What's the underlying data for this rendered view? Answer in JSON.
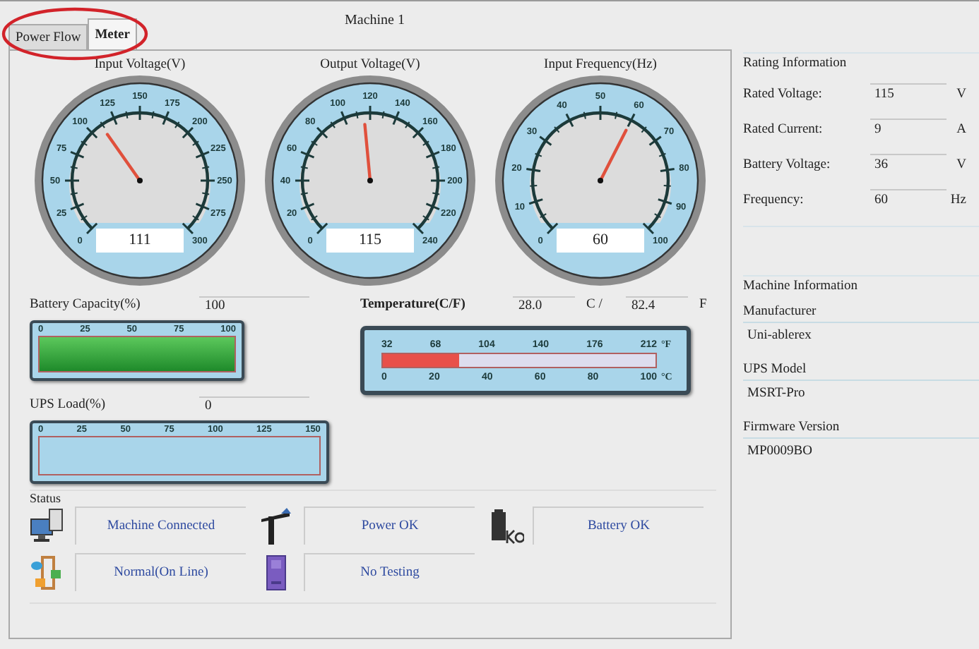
{
  "window": {
    "title": "Machine 1"
  },
  "tabs": [
    {
      "label": "Power Flow",
      "selected": false
    },
    {
      "label": "Meter",
      "selected": true
    }
  ],
  "annotations": [
    {
      "kind": "ellipse"
    }
  ],
  "gauges": [
    {
      "title": "Input Voltage(V)",
      "ticks": [
        "0",
        "25",
        "50",
        "75",
        "100",
        "125",
        "150",
        "175",
        "200",
        "225",
        "250",
        "275",
        "300"
      ],
      "level": 0.37,
      "value": "111"
    },
    {
      "title": "Output Voltage(V)",
      "ticks": [
        "0",
        "20",
        "40",
        "60",
        "80",
        "100",
        "120",
        "140",
        "160",
        "180",
        "200",
        "220",
        "240"
      ],
      "level": 0.48,
      "value": "115"
    },
    {
      "title": "Input Frequency(Hz)",
      "ticks": [
        "0",
        "10",
        "20",
        "30",
        "40",
        "50",
        "60",
        "70",
        "80",
        "90",
        "100"
      ],
      "level": 0.6,
      "value": "60"
    }
  ],
  "battery": {
    "label": "Battery Capacity(%)",
    "value": "100",
    "ticks": [
      "0",
      "25",
      "50",
      "75",
      "100"
    ],
    "level": 1
  },
  "load": {
    "label": "UPS Load(%)",
    "value": "0",
    "ticks": [
      "0",
      "25",
      "50",
      "75",
      "100",
      "125",
      "150"
    ],
    "level": 0
  },
  "temperature": {
    "label": "Temperature(C/F)",
    "celsius": "28.0",
    "celsius_unit": "C /",
    "fahrenheit": "82.4",
    "fahrenheit_unit": "F",
    "f_ticks": [
      "32",
      "68",
      "104",
      "140",
      "176",
      "212"
    ],
    "f_scale": "°F",
    "c_ticks": [
      "0",
      "20",
      "40",
      "60",
      "80",
      "100"
    ],
    "c_scale": "°C",
    "level": 0.28
  },
  "status": {
    "label": "Status",
    "items": [
      {
        "kind": "computer",
        "text": "Machine Connected"
      },
      {
        "kind": "pole",
        "text": "Power OK"
      },
      {
        "kind": "battery",
        "text": "Battery OK"
      },
      {
        "kind": "flow",
        "text": "Normal(On Line)"
      },
      {
        "kind": "device",
        "text": "No Testing"
      }
    ]
  },
  "rating": {
    "title": "Rating Information",
    "rows": [
      {
        "label": "Rated Voltage:",
        "value": "115",
        "unit": "V"
      },
      {
        "label": "Rated Current:",
        "value": "9",
        "unit": "A"
      },
      {
        "label": "Battery Voltage:",
        "value": "36",
        "unit": "V"
      },
      {
        "label": "Frequency:",
        "value": "60",
        "unit": "Hz"
      }
    ]
  },
  "machine": {
    "title": "Machine Information",
    "fields": [
      {
        "label": "Manufacturer",
        "value": "Uni-ablerex"
      },
      {
        "label": "UPS Model",
        "value": "MSRT-Pro"
      },
      {
        "label": "Firmware Version",
        "value": "MP0009BO"
      }
    ]
  }
}
